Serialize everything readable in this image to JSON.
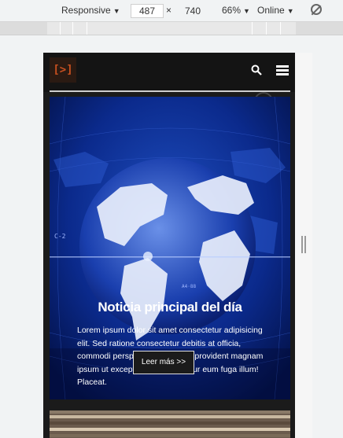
{
  "devtools": {
    "device_mode": "Responsive",
    "width": "487",
    "times": "×",
    "height": "740",
    "zoom": "66%",
    "network": "Online",
    "rotate_icon": "rotate-icon"
  },
  "site": {
    "logo": "[>]",
    "icons": {
      "search": "search-icon",
      "menu": "hamburger-menu-icon"
    }
  },
  "hero": {
    "title": "Noticia principal del día",
    "body": "Lorem ipsum dolor sit amet consectetur adipisicing elit. Sed ratione consectetur debitis at officia, commodi perspiciatis placeat et provident magnam ipsum ut excepturi, nihil id tenetur eum fuga illum! Placeat.",
    "button_label": "Leer más >>",
    "background": "globe-world-map-image",
    "overlay_texts": [
      "C-2",
      "A4·88"
    ]
  },
  "colors": {
    "page_bg": "#1b1b1b",
    "hero_blue": "#0a2a8a",
    "logo_orange": "#c85020"
  }
}
